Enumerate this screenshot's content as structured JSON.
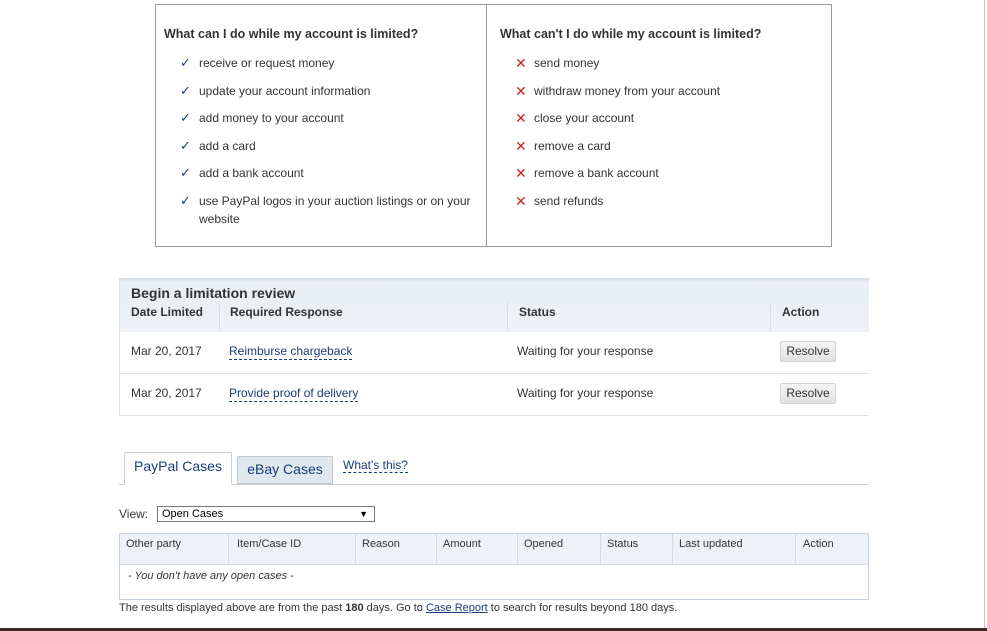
{
  "limits": {
    "can_heading": "What can I do while my account is limited?",
    "can_items": [
      "receive or request money",
      "update your account information",
      "add money to your account",
      "add a card",
      "add a bank account",
      "use PayPal logos in your auction listings or on your website"
    ],
    "cant_heading": "What can't I do while my account is limited?",
    "cant_items": [
      "send money",
      "withdraw money from your account",
      "close your account",
      "remove a card",
      "remove a bank account",
      "send refunds"
    ],
    "can_mark": "✓",
    "cant_mark": "✕"
  },
  "review": {
    "title": "Begin a limitation review",
    "columns": [
      "Date Limited",
      "Required Response",
      "Status",
      "Action"
    ],
    "rows": [
      {
        "date": "Mar 20, 2017",
        "response": "Reimburse chargeback",
        "status": "Waiting for your response",
        "action": "Resolve"
      },
      {
        "date": "Mar 20, 2017",
        "response": "Provide proof of delivery",
        "status": "Waiting for your response",
        "action": "Resolve"
      }
    ]
  },
  "tabs": {
    "items": [
      "PayPal Cases",
      "eBay Cases"
    ],
    "active": "PayPal Cases",
    "help_link": "What's this?"
  },
  "view": {
    "label": "View:",
    "selected": "Open Cases"
  },
  "cases": {
    "columns": [
      "Other party",
      "Item/Case ID",
      "Reason",
      "Amount",
      "Opened",
      "Status",
      "Last updated",
      "Action"
    ],
    "empty_message": "- You don't have any open cases -"
  },
  "footer": {
    "prefix": "The results displayed above are from the past ",
    "days": "180",
    "middle": " days. Go to ",
    "link": "Case Report",
    "suffix": " to search for results beyond 180 days."
  },
  "colors": {
    "link_blue": "#1a3d78",
    "check_blue": "#1a3d78",
    "cross_red": "#cc2222",
    "table_head_bg": "#eef2f7"
  }
}
